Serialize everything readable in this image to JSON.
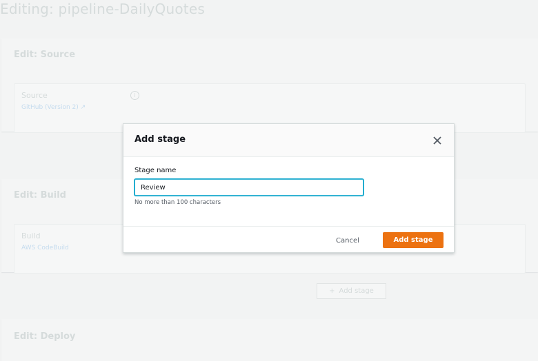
{
  "page": {
    "title": "Editing: pipeline-DailyQuotes"
  },
  "stages": [
    {
      "header": "Edit: Source",
      "action_name": "Source",
      "action_provider": "GitHub (Version 2)"
    },
    {
      "header": "Edit: Build",
      "action_name": "Build",
      "action_provider": "AWS CodeBuild"
    },
    {
      "header": "Edit: Deploy"
    }
  ],
  "background_add_stage": {
    "label": "Add stage",
    "icon": "plus-icon"
  },
  "modal": {
    "title": "Add stage",
    "close_icon": "close-icon",
    "field_label": "Stage name",
    "input_value": "Review",
    "constraint": "No more than 100 characters",
    "cancel_label": "Cancel",
    "submit_label": "Add stage"
  },
  "colors": {
    "accent": "#ec7211",
    "focus": "#00a1c9",
    "text": "#16191f"
  }
}
